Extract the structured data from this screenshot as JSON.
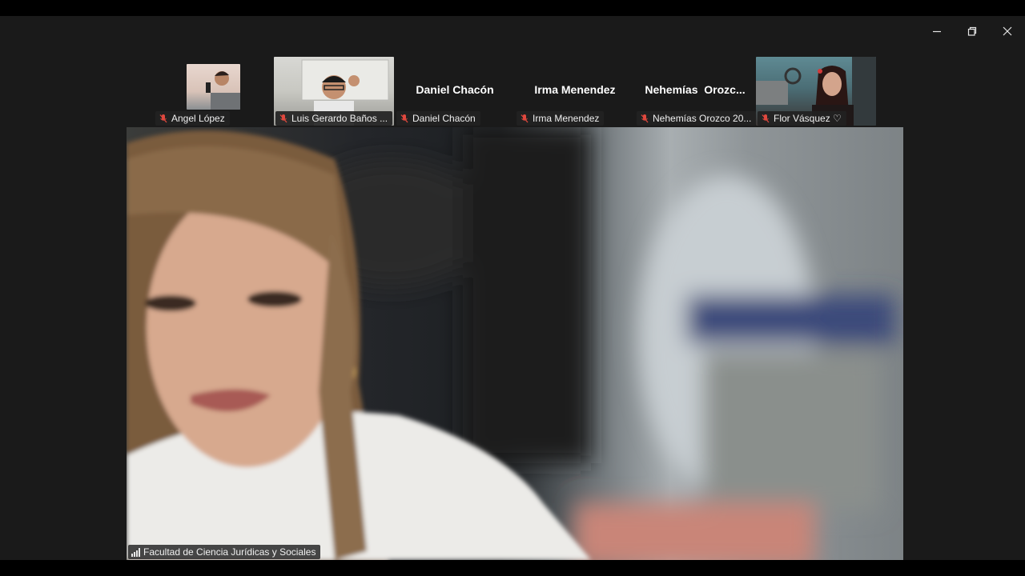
{
  "window": {
    "controls": [
      "minimize-icon",
      "restore-icon",
      "close-icon"
    ]
  },
  "participants": [
    {
      "name": "Angel López",
      "has_video": true,
      "muted": true
    },
    {
      "name": "Luis Gerardo Baños ...",
      "has_video": true,
      "muted": true
    },
    {
      "name": "Daniel Chacón",
      "display": "Daniel Chacón",
      "has_video": false,
      "muted": true
    },
    {
      "name": "Irma Menendez",
      "display": "Irma Menendez",
      "has_video": false,
      "muted": true
    },
    {
      "name": "Nehemías Orozco 20...",
      "display": "Nehemías  Orozc...",
      "has_video": false,
      "muted": true
    },
    {
      "name": "Flor Vásquez ♡",
      "has_video": true,
      "muted": true
    }
  ],
  "active_speaker": {
    "name": "Facultad de Ciencia Jurídicas y Sociales",
    "icon": "signal-strength-icon"
  },
  "colors": {
    "muted_icon": "#e0483e",
    "background": "#1a1a1a"
  }
}
